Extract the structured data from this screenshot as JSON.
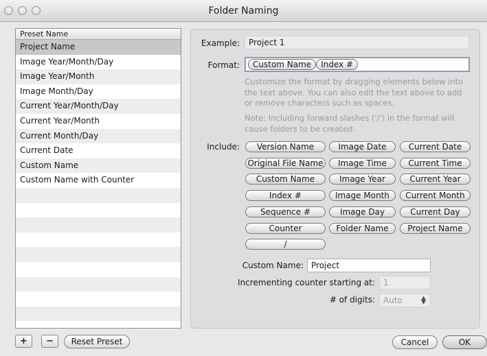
{
  "window": {
    "title": "Folder Naming"
  },
  "preset_list": {
    "header": "Preset Name",
    "items": [
      "Project Name",
      "Image Year/Month/Day",
      "Image Year/Month",
      "Image Month/Day",
      "Current Year/Month/Day",
      "Current Year/Month",
      "Current Month/Day",
      "Current Date",
      "Custom Name",
      "Custom Name with Counter"
    ],
    "selected_index": 0
  },
  "bottom_left": {
    "add_label": "+",
    "remove_label": "−",
    "reset_label": "Reset Preset"
  },
  "form": {
    "example_label": "Example:",
    "example_value": "Project 1",
    "format_label": "Format:",
    "format_tokens": [
      "Custom Name",
      "Index #"
    ],
    "help_1": "Customize the format by dragging elements below into the text above. You can also edit the text above to add or remove characters such as spaces.",
    "help_2": "Note: Including forward slashes ('/') in the format will cause folders to be created.",
    "include_label": "Include:",
    "elements": [
      [
        "Version Name",
        "Image Date",
        "Current Date"
      ],
      [
        "Original File Name",
        "Image Time",
        "Current Time"
      ],
      [
        "Custom Name",
        "Image Year",
        "Current Year"
      ],
      [
        "Index #",
        "Image Month",
        "Current Month"
      ],
      [
        "Sequence #",
        "Image Day",
        "Current Day"
      ],
      [
        "Counter",
        "Folder Name",
        "Project Name"
      ],
      [
        "/"
      ]
    ],
    "custom_name_label": "Custom Name:",
    "custom_name_value": "Project",
    "counter_label": "Incrementing counter starting at:",
    "counter_value": "1",
    "digits_label": "# of digits:",
    "digits_value": "Auto"
  },
  "bottom_right": {
    "cancel_label": "Cancel",
    "ok_label": "OK"
  }
}
